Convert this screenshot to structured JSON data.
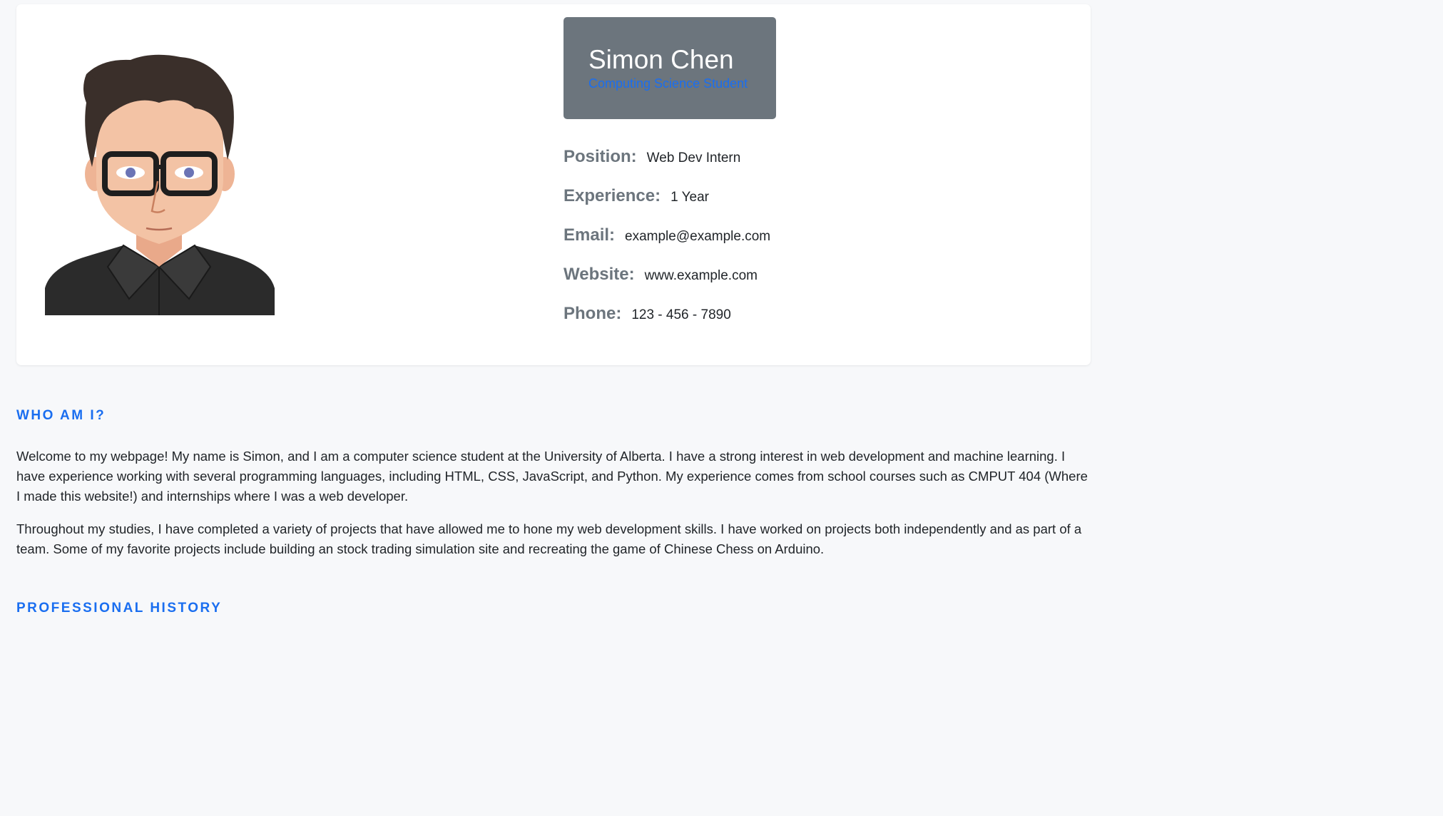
{
  "profile": {
    "name": "Simon Chen",
    "title": "Computing Science Student",
    "colors": {
      "name_box_bg": "#6c757d",
      "accent": "#1a6ef0"
    }
  },
  "info": [
    {
      "label": "Position:",
      "value": "Web Dev Intern"
    },
    {
      "label": "Experience:",
      "value": "1 Year"
    },
    {
      "label": "Email:",
      "value": "example@example.com"
    },
    {
      "label": "Website:",
      "value": "www.example.com"
    },
    {
      "label": "Phone:",
      "value": "123 - 456 - 7890"
    }
  ],
  "about": {
    "heading": "Who am I?",
    "paragraphs": [
      "Welcome to my webpage! My name is Simon, and I am a computer science student at the University of Alberta. I have a strong interest in web development and machine learning. I have experience working with several programming languages, including HTML, CSS, JavaScript, and Python. My experience comes from school courses such as CMPUT 404 (Where I made this website!) and internships where I was a web developer.",
      "Throughout my studies, I have completed a variety of projects that have allowed me to hone my web development skills. I have worked on projects both independently and as part of a team. Some of my favorite projects include building an stock trading simulation site and recreating the game of Chinese Chess on Arduino."
    ]
  },
  "history": {
    "heading": "Professional History"
  }
}
